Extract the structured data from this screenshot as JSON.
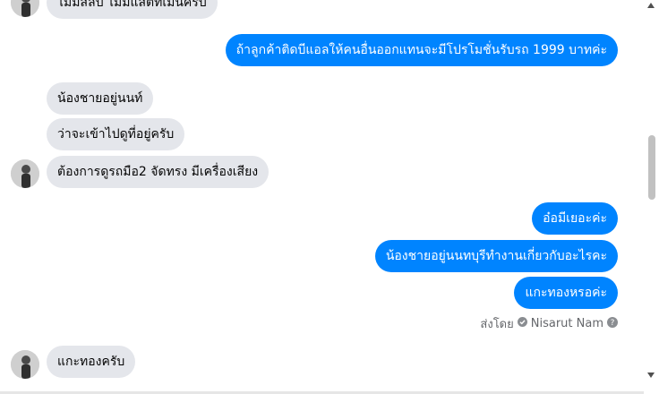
{
  "messages": [
    {
      "id": "m0",
      "side": "in",
      "text": "ไม่มีสลิป ไม่มีแสตัทเม้นครับ"
    },
    {
      "id": "m1",
      "side": "out",
      "text": "ถ้าลูกค้าติดบีแอลให้คนอื่นออกแทนจะมีโปรโมชั่นรับรถ 1999 บาทค่ะ"
    },
    {
      "id": "m2",
      "side": "in",
      "text": "น้องชายอยู่นนท์"
    },
    {
      "id": "m3",
      "side": "in",
      "text": "ว่าจะเข้าไปดูที่อยู่ครับ"
    },
    {
      "id": "m4",
      "side": "in",
      "text": "ต้องการดูรถมือ2 จัดทรง มีเครื่องเสียง"
    },
    {
      "id": "m5",
      "side": "out",
      "text": "อ๋อมีเยอะค่ะ"
    },
    {
      "id": "m6",
      "side": "out",
      "text": "น้องชายอยู่นนทบุรีทำงานเกี่ยวกับอะไรคะ"
    },
    {
      "id": "m7",
      "side": "out",
      "text": "แกะทองหรอค่ะ"
    },
    {
      "id": "m8",
      "side": "in",
      "text": "แกะทองครับ"
    }
  ],
  "sent_by": {
    "prefix": "ส่งโดย",
    "name": "Nisarut Nam"
  },
  "icons": {
    "check": "verified-check-icon",
    "help": "question-circle-icon",
    "avatar": "user-avatar-icon"
  },
  "colors": {
    "outgoing": "#0084ff",
    "incoming": "#e4e6eb",
    "meta_text": "#65676b"
  }
}
